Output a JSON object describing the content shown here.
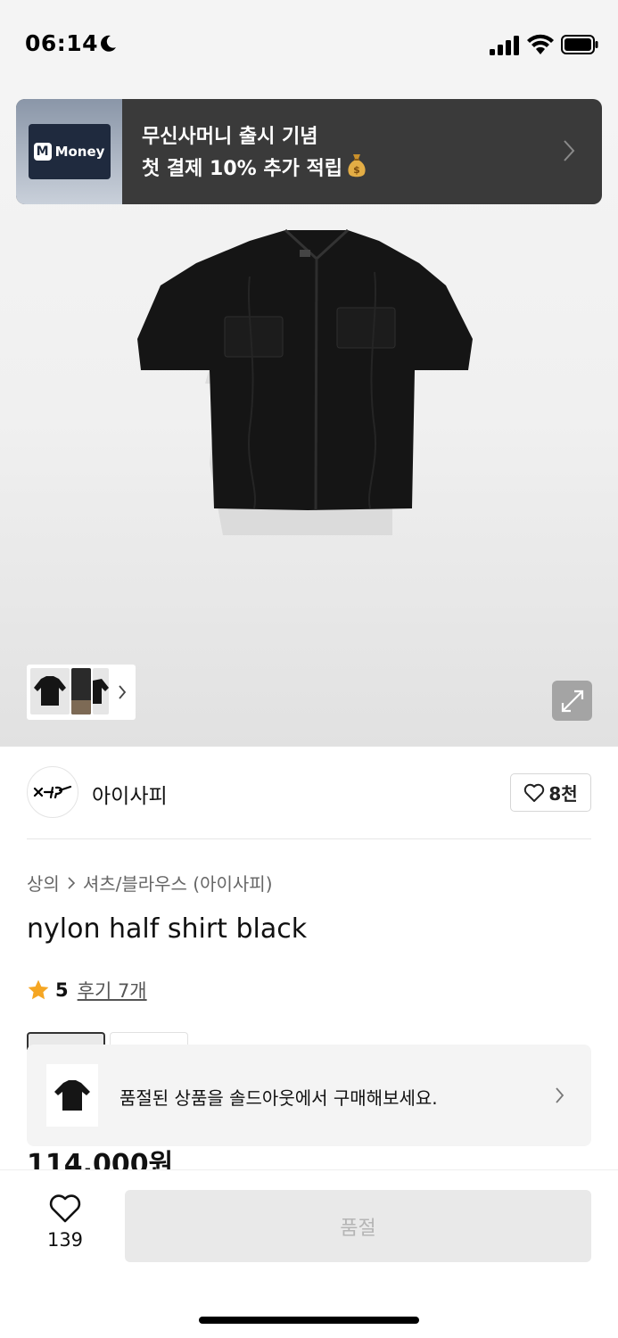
{
  "status_bar": {
    "time": "06:14",
    "icons": [
      "moon-icon",
      "signal-icon",
      "wifi-icon",
      "battery-icon"
    ]
  },
  "banner": {
    "logo_letter": "M",
    "logo_text": "Money",
    "line1": "무신사머니 출시 기념",
    "line2": "첫 결제 10% 추가 적립",
    "emoji_icon": "money-bag-icon"
  },
  "brand": {
    "name": "아이사피",
    "follow_count": "8천"
  },
  "breadcrumb": {
    "category": "상의",
    "subcategory": "셔츠/블라우스 (아이사피)"
  },
  "product": {
    "title": "nylon half shirt black",
    "rating": "5",
    "review_text": "후기 7개",
    "price": "114,000원"
  },
  "soldout_card": {
    "text": "품절된 상품을 솔드아웃에서 구매해보세요."
  },
  "bottom_bar": {
    "like_count": "139",
    "buy_label": "품절"
  },
  "colors": {
    "banner_bg": "#3a3a3a",
    "star": "#f5a623",
    "soldout_button_bg": "#e9e9e9",
    "soldout_button_text": "#b5b5b5"
  }
}
